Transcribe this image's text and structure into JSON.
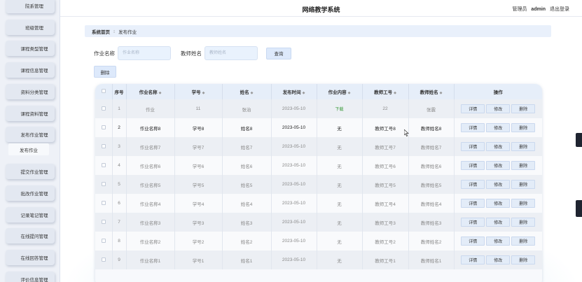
{
  "header": {
    "title": "网络教学系统",
    "role": "管理员",
    "username": "admin",
    "logout": "退出登录"
  },
  "sidebar": {
    "items": [
      {
        "label": "院系管理"
      },
      {
        "label": "班级管理"
      },
      {
        "label": "课程类型管理"
      },
      {
        "label": "课程信息管理"
      },
      {
        "label": "资料分类管理"
      },
      {
        "label": "课程资料管理"
      },
      {
        "label": "发布作业管理"
      },
      {
        "label": "提交作业管理"
      },
      {
        "label": "批改作业管理"
      },
      {
        "label": "记录笔记管理"
      },
      {
        "label": "在线提问管理"
      },
      {
        "label": "在线回答管理"
      },
      {
        "label": "评价信息管理"
      }
    ],
    "sub_item": {
      "label": "发布作业"
    }
  },
  "breadcrumb": {
    "home": "系统首页",
    "separator": "⁝",
    "current": "发布作业"
  },
  "search": {
    "name_label": "作业名称",
    "name_placeholder": "作业名称",
    "teacher_label": "教师姓名",
    "teacher_placeholder": "教师姓名",
    "search_button": "查询"
  },
  "toolbar": {
    "delete_button": "删除"
  },
  "table": {
    "headers": {
      "index": "序号",
      "name": "作业名称",
      "student_no": "学号",
      "student_name": "姓名",
      "publish_time": "发布时间",
      "content": "作业内容",
      "teacher_no": "教师工号",
      "teacher_name": "教师姓名",
      "actions": "操作"
    },
    "sort_icon": "◆",
    "action_labels": {
      "detail": "详情",
      "edit": "修改",
      "delete": "删除"
    },
    "rows": [
      {
        "index": "1",
        "name": "作业",
        "student_no": "11",
        "student_name": "张治",
        "publish_time": "2023-05-10",
        "content": "下载",
        "teacher_no": "22",
        "teacher_name": "张震"
      },
      {
        "index": "2",
        "name": "作业名称8",
        "student_no": "学号8",
        "student_name": "姓名8",
        "publish_time": "2023-05-10",
        "content": "无",
        "teacher_no": "教师工号8",
        "teacher_name": "教师姓名8"
      },
      {
        "index": "3",
        "name": "作业名称7",
        "student_no": "学号7",
        "student_name": "姓名7",
        "publish_time": "2023-05-10",
        "content": "无",
        "teacher_no": "教师工号7",
        "teacher_name": "教师姓名7"
      },
      {
        "index": "4",
        "name": "作业名称6",
        "student_no": "学号6",
        "student_name": "姓名6",
        "publish_time": "2023-05-10",
        "content": "无",
        "teacher_no": "教师工号6",
        "teacher_name": "教师姓名6"
      },
      {
        "index": "5",
        "name": "作业名称5",
        "student_no": "学号5",
        "student_name": "姓名5",
        "publish_time": "2023-05-10",
        "content": "无",
        "teacher_no": "教师工号5",
        "teacher_name": "教师姓名5"
      },
      {
        "index": "6",
        "name": "作业名称4",
        "student_no": "学号4",
        "student_name": "姓名4",
        "publish_time": "2023-05-10",
        "content": "无",
        "teacher_no": "教师工号4",
        "teacher_name": "教师姓名4"
      },
      {
        "index": "7",
        "name": "作业名称3",
        "student_no": "学号3",
        "student_name": "姓名3",
        "publish_time": "2023-05-10",
        "content": "无",
        "teacher_no": "教师工号3",
        "teacher_name": "教师姓名3"
      },
      {
        "index": "8",
        "name": "作业名称2",
        "student_no": "学号2",
        "student_name": "姓名2",
        "publish_time": "2023-05-10",
        "content": "无",
        "teacher_no": "教师工号2",
        "teacher_name": "教师姓名2"
      },
      {
        "index": "9",
        "name": "作业名称1",
        "student_no": "学号1",
        "student_name": "姓名1",
        "publish_time": "2023-05-10",
        "content": "无",
        "teacher_no": "教师工号1",
        "teacher_name": "教师姓名1"
      }
    ]
  }
}
